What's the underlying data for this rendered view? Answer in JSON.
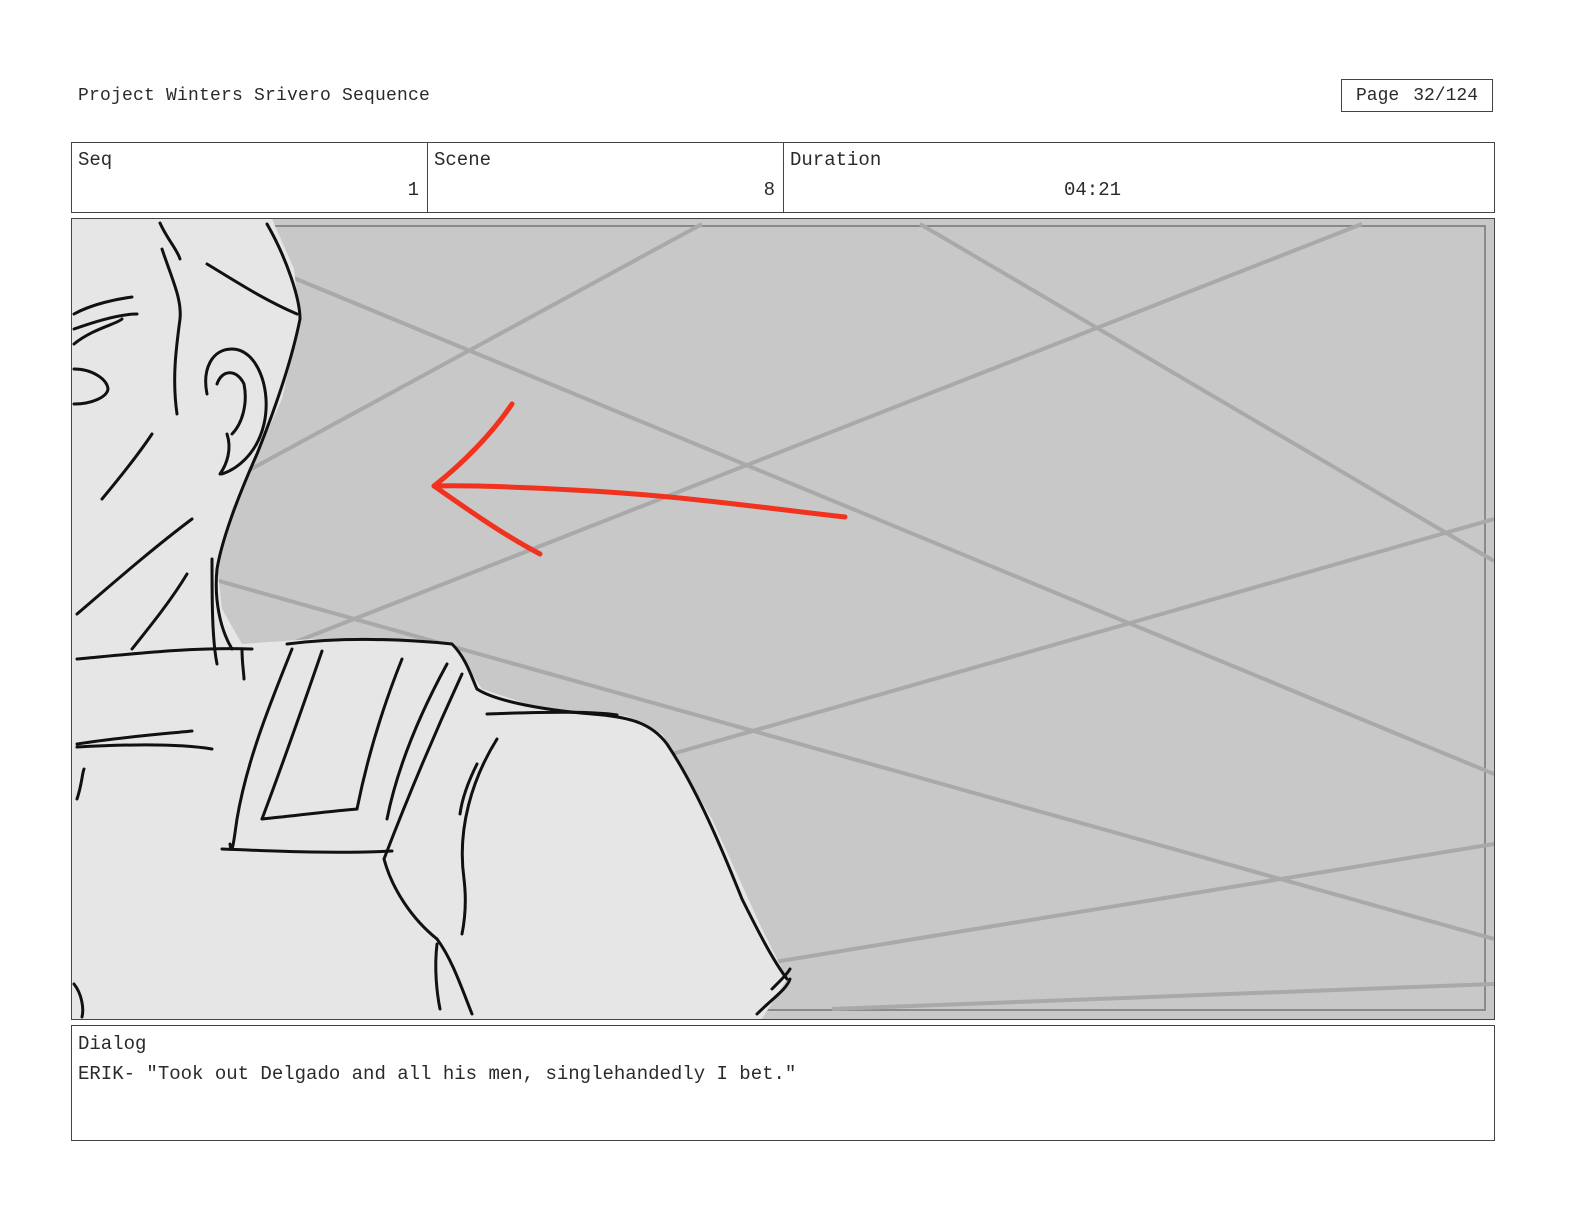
{
  "header": {
    "project_title": "Project Winters Srivero Sequence",
    "page_label": "Page",
    "page_number": "32/124"
  },
  "info": {
    "seq_label": "Seq",
    "seq_value": "1",
    "scene_label": "Scene",
    "scene_value": "8",
    "duration_label": "Duration",
    "duration_value": "04:21"
  },
  "panel": {
    "background_color": "#c8c8c8",
    "figure_fill": "#e6e6e6",
    "line_color": "#111111",
    "grid_line_color": "#a9a9a9",
    "arrow_color": "#f0321e",
    "arrow_direction": "left"
  },
  "dialog": {
    "label": "Dialog",
    "text": "ERIK- \"Took out Delgado and all his men, singlehandedly I bet.\""
  }
}
